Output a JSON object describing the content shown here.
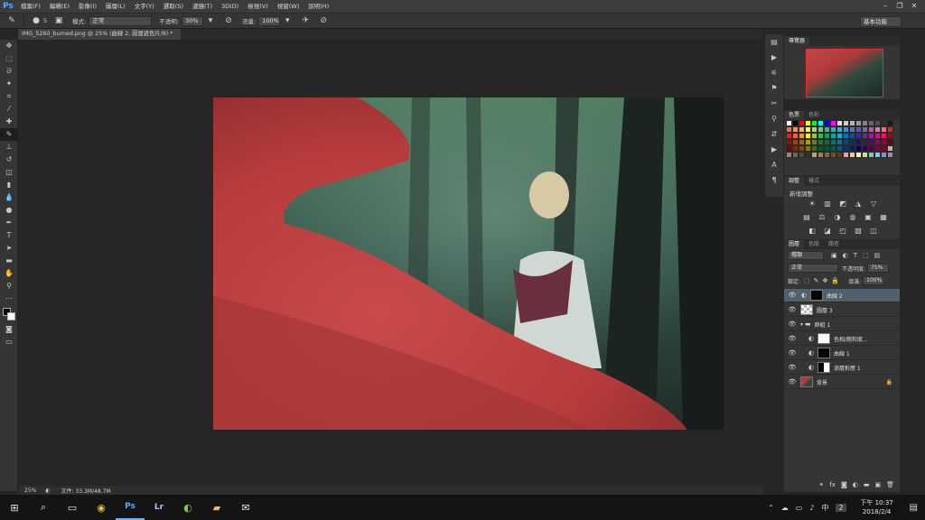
{
  "menubar": {
    "logo": "Ps",
    "items": [
      "檔案(F)",
      "編輯(E)",
      "影像(I)",
      "圖層(L)",
      "文字(Y)",
      "選取(S)",
      "濾鏡(T)",
      "3D(D)",
      "檢視(V)",
      "視窗(W)",
      "說明(H)"
    ]
  },
  "options": {
    "mode_label": "模式:",
    "mode_value": "正常",
    "opacity_label": "不透明:",
    "opacity_value": "30%",
    "flow_label": "流量:",
    "flow_value": "100%",
    "brush_size": "5",
    "workspace": "基本功能"
  },
  "document": {
    "tab_title": "IMG_5260_burned.png @ 25% (曲線 2, 圖層遮色片/8) *",
    "zoom": "25%",
    "file_info": "文件: 33.3M/48.7M"
  },
  "navigator": {
    "tabs": [
      "導覽器"
    ]
  },
  "swatches": {
    "tabs": [
      "色票",
      "色彩"
    ],
    "colors": [
      "#ffffff",
      "#000000",
      "#ff0000",
      "#ffff00",
      "#00ff00",
      "#00ffff",
      "#0000ff",
      "#ff00ff",
      "#e6e6e6",
      "#cccccc",
      "#b3b3b3",
      "#999999",
      "#808080",
      "#666666",
      "#4d4d4d",
      "#333333",
      "#1a1a1a",
      "#f26c4f",
      "#f68e55",
      "#fbaf5c",
      "#fff467",
      "#acd372",
      "#7cc576",
      "#3bb878",
      "#1abbb4",
      "#00bff3",
      "#438ccb",
      "#5574b9",
      "#605ca8",
      "#855fa8",
      "#a763a8",
      "#f06ea9",
      "#f26d7d",
      "#ed1c24",
      "#ed1c24",
      "#f26522",
      "#f7941d",
      "#fff200",
      "#8dc63f",
      "#39b54a",
      "#00a651",
      "#00a99d",
      "#00aeef",
      "#0072bc",
      "#0054a6",
      "#2e3192",
      "#662d91",
      "#92278f",
      "#ec008c",
      "#ed145b",
      "#9e0b0f",
      "#9e0b0f",
      "#a0410d",
      "#a36209",
      "#aba000",
      "#598527",
      "#1a7b30",
      "#007236",
      "#00746b",
      "#0076a3",
      "#004b80",
      "#003471",
      "#1b1464",
      "#440e62",
      "#630460",
      "#9e005d",
      "#9e0039",
      "#790000",
      "#790000",
      "#7b2e00",
      "#7d4900",
      "#827b00",
      "#406618",
      "#005e20",
      "#005826",
      "#005952",
      "#005b7f",
      "#003663",
      "#002157",
      "#0d004c",
      "#32004b",
      "#4b0049",
      "#7b0046",
      "#7a0026",
      "#c7b299",
      "#998675",
      "#736357",
      "#534741",
      "#37302a",
      "#c69c6d",
      "#a67c52",
      "#8c6239",
      "#754c24",
      "#603913",
      "#f5989d",
      "#fdc689",
      "#fff799",
      "#c4df9b",
      "#82ca9c",
      "#6dcff6",
      "#8393ca",
      "#a187be"
    ]
  },
  "adjustments": {
    "tabs": [
      "調整",
      "樣式"
    ],
    "heading": "新增調整",
    "row1": [
      "☀",
      "▥",
      "◩",
      "◮",
      "▽"
    ],
    "row2": [
      "▤",
      "⚖",
      "◑",
      "◍",
      "▣",
      "▦"
    ],
    "row3": [
      "◧",
      "◪",
      "◰",
      "▧",
      "◫"
    ]
  },
  "layers": {
    "tabs": [
      "圖層",
      "色版",
      "路徑"
    ],
    "filter_label": "種類",
    "blend_mode": "正常",
    "opacity_label": "不透明度:",
    "opacity_value": "75%",
    "lock_label": "鎖定:",
    "fill_label": "填滿:",
    "fill_value": "100%",
    "items": [
      {
        "name": "曲線 2",
        "selected": true,
        "indent": 0
      },
      {
        "name": "圖層 3",
        "selected": false,
        "indent": 0
      },
      {
        "name": "群組 1",
        "selected": false,
        "indent": 0
      },
      {
        "name": "色相/飽和度...",
        "selected": false,
        "indent": 1
      },
      {
        "name": "曲線 1",
        "selected": false,
        "indent": 1
      },
      {
        "name": "漸層對應 1",
        "selected": false,
        "indent": 1
      },
      {
        "name": "背景",
        "selected": false,
        "indent": 0
      }
    ]
  },
  "taskbar": {
    "apps": [
      "⊞",
      "⌕",
      "▭",
      "◉",
      "Ps",
      "Lr",
      "◐",
      "▰",
      "✉"
    ],
    "tray": [
      "⌃",
      "☁",
      "▭",
      "♪",
      "中"
    ],
    "notify_count": "2",
    "time": "下午 10:37",
    "date": "2018/2/4"
  }
}
